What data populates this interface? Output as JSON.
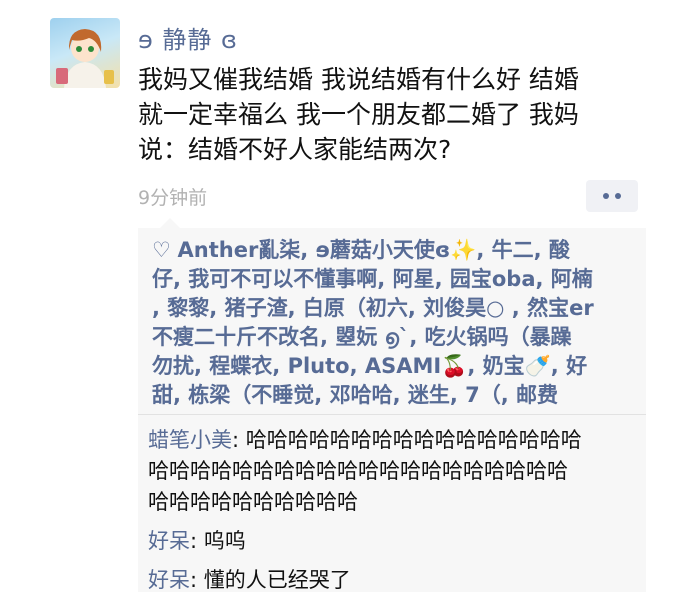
{
  "post": {
    "author": "ɘ 静静 ɞ",
    "text_lines": [
      "我妈又催我结婚 我说结婚有什么好 结婚",
      "就一定幸福么 我一个朋友都二婚了 我妈",
      "说：结婚不好人家能结两次?"
    ],
    "time": "9分钟前"
  },
  "likes": {
    "icon": "heart-outline-icon",
    "lines": [
      "Anther亂柒, ɘ蘑菇小天使ɞ✨, 牛二, 酸",
      "仔, 我可不可以不懂事啊, 阿星, 园宝oba, 阿楠",
      ", 黎黎, 猪子渣, 白原（初六, 刘俊昊○ , 然宝er",
      "不瘦二十斤不改名, 曌妧  ൭`, 吃火锅吗（暴躁",
      "勿扰, 程蝶衣, Pluto, ASAMI🍒, 奶宝🍼, 好",
      "甜, 栋梁（不睡觉, 邓哈哈, 迷生, 7（, 邮费"
    ]
  },
  "comments": [
    {
      "name": "蜡笔小美",
      "lines": [
        ": 哈哈哈哈哈哈哈哈哈哈哈哈哈哈哈哈",
        "哈哈哈哈哈哈哈哈哈哈哈哈哈哈哈哈哈哈哈哈",
        "哈哈哈哈哈哈哈哈哈哈"
      ]
    },
    {
      "name": "好呆",
      "lines": [
        ": 呜呜"
      ]
    },
    {
      "name": "好呆",
      "lines": [
        ": 懂的人已经哭了"
      ]
    }
  ],
  "colors": {
    "link": "#576b95",
    "text": "#111111",
    "muted": "#b2b2b2",
    "panel": "#f7f7f7"
  }
}
